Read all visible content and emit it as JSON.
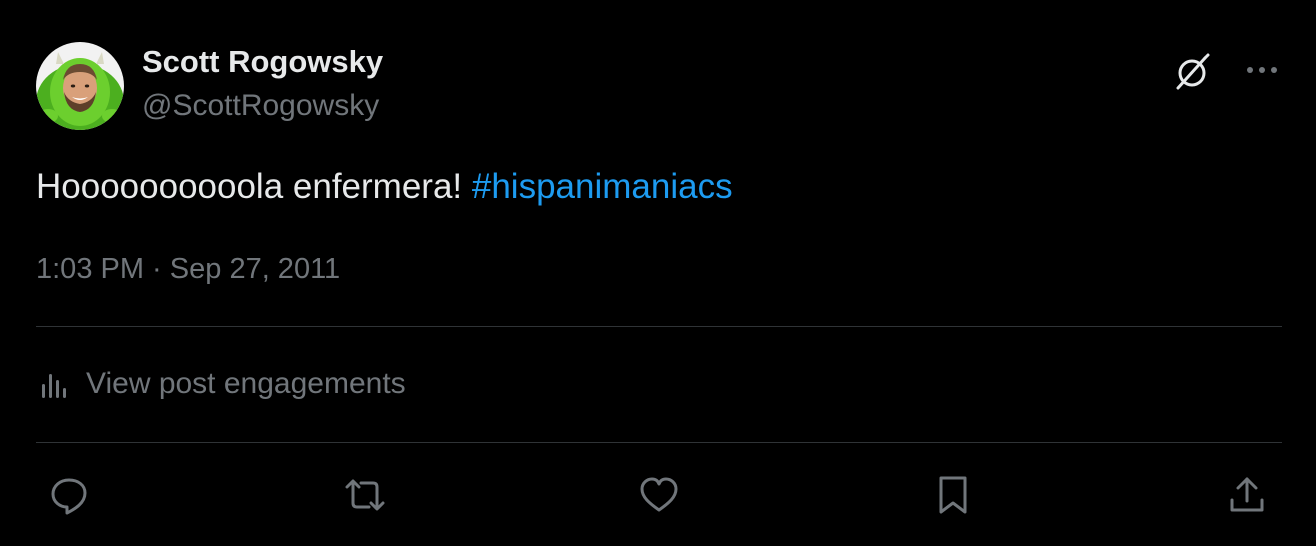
{
  "author": {
    "display_name": "Scott Rogowsky",
    "handle": "@ScottRogowsky",
    "avatar_icon": "profile-photo"
  },
  "tweet": {
    "text_prefix": "Hoooooooooola enfermera! ",
    "hashtag": "#hispanimaniacs",
    "time": "1:03 PM",
    "separator": " · ",
    "date": "Sep 27, 2011"
  },
  "engagements": {
    "label": "View post engagements",
    "icon": "analytics-icon"
  },
  "header_actions": {
    "grok_icon": "grok-icon",
    "more_icon": "more-options-icon"
  },
  "actions": [
    {
      "name": "reply",
      "icon": "reply-icon"
    },
    {
      "name": "repost",
      "icon": "repost-icon"
    },
    {
      "name": "like",
      "icon": "heart-icon"
    },
    {
      "name": "bookmark",
      "icon": "bookmark-icon"
    },
    {
      "name": "share",
      "icon": "share-icon"
    }
  ],
  "colors": {
    "background": "#000000",
    "primary_text": "#e7e9ea",
    "secondary_text": "#71767b",
    "link": "#1d9bf0",
    "divider": "#2f3336"
  }
}
